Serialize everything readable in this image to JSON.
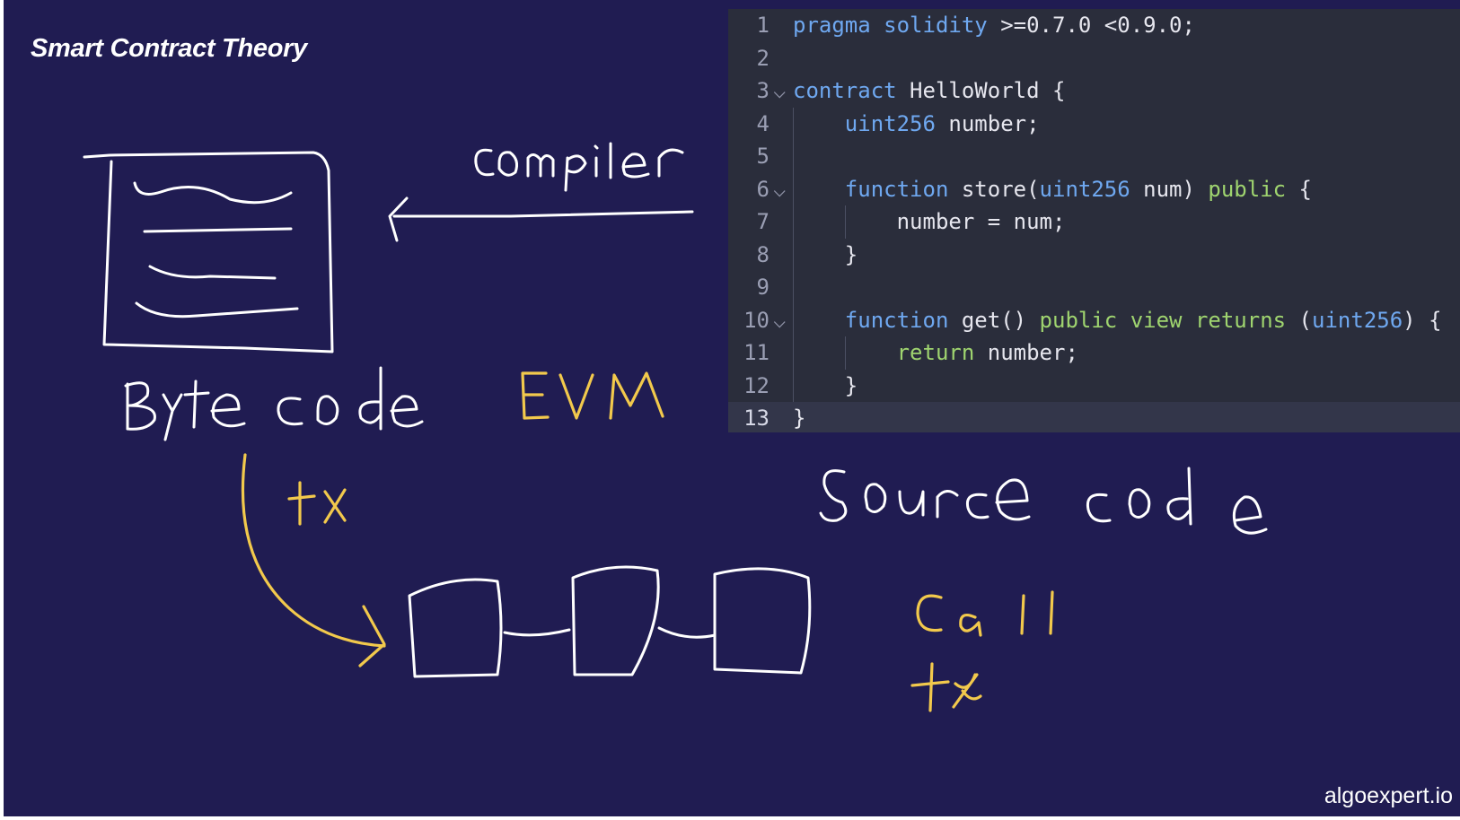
{
  "title": "Smart Contract Theory",
  "brand": "algoexpert.io",
  "colors": {
    "background": "#201c52",
    "ink_white": "#ffffff",
    "ink_yellow": "#f2c94c",
    "editor_bg": "#2a2d3b"
  },
  "handwritten": {
    "compiler": "compiler",
    "byte_code": "Byte code",
    "evm": "EVM",
    "tx": "tx",
    "source_code": "Source code",
    "call": "Call",
    "tx2": "tx"
  },
  "editor": {
    "lines": [
      {
        "n": "1",
        "fold": false,
        "tokens": [
          [
            "kw",
            "pragma"
          ],
          [
            "plain",
            " "
          ],
          [
            "kw",
            "solidity"
          ],
          [
            "plain",
            " >=0.7.0 <0.9.0;"
          ]
        ]
      },
      {
        "n": "2",
        "fold": false,
        "tokens": []
      },
      {
        "n": "3",
        "fold": true,
        "tokens": [
          [
            "kw",
            "contract"
          ],
          [
            "plain",
            " HelloWorld {"
          ]
        ]
      },
      {
        "n": "4",
        "fold": false,
        "tokens": [
          [
            "plain",
            "    "
          ],
          [
            "ty",
            "uint256"
          ],
          [
            "plain",
            " number;"
          ]
        ]
      },
      {
        "n": "5",
        "fold": false,
        "tokens": []
      },
      {
        "n": "6",
        "fold": true,
        "tokens": [
          [
            "plain",
            "    "
          ],
          [
            "kw",
            "function"
          ],
          [
            "plain",
            " store("
          ],
          [
            "ty",
            "uint256"
          ],
          [
            "plain",
            " num) "
          ],
          [
            "mod",
            "public"
          ],
          [
            "plain",
            " {"
          ]
        ]
      },
      {
        "n": "7",
        "fold": false,
        "tokens": [
          [
            "plain",
            "        number = num;"
          ]
        ]
      },
      {
        "n": "8",
        "fold": false,
        "tokens": [
          [
            "plain",
            "    }"
          ]
        ]
      },
      {
        "n": "9",
        "fold": false,
        "tokens": []
      },
      {
        "n": "10",
        "fold": true,
        "tokens": [
          [
            "plain",
            "    "
          ],
          [
            "kw",
            "function"
          ],
          [
            "plain",
            " get() "
          ],
          [
            "mod",
            "public"
          ],
          [
            "plain",
            " "
          ],
          [
            "mod",
            "view"
          ],
          [
            "plain",
            " "
          ],
          [
            "mod",
            "returns"
          ],
          [
            "plain",
            " ("
          ],
          [
            "ty",
            "uint256"
          ],
          [
            "plain",
            ") {"
          ]
        ]
      },
      {
        "n": "11",
        "fold": false,
        "tokens": [
          [
            "plain",
            "        "
          ],
          [
            "mod",
            "return"
          ],
          [
            "plain",
            " number;"
          ]
        ]
      },
      {
        "n": "12",
        "fold": false,
        "tokens": [
          [
            "plain",
            "    }"
          ]
        ]
      },
      {
        "n": "13",
        "fold": false,
        "current": true,
        "tokens": [
          [
            "plain",
            "}"
          ]
        ]
      }
    ]
  }
}
